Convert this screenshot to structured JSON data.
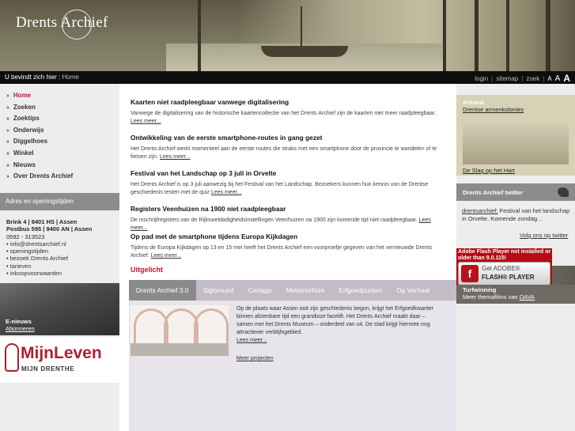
{
  "header": {
    "logo_text": "Drents Archief"
  },
  "topbar": {
    "breadcrumb_label": "U bevindt zich hier :",
    "breadcrumb_current": "Home",
    "links": [
      "login",
      "sitemap",
      "zoek"
    ],
    "font_sizes": [
      "A",
      "A",
      "A"
    ]
  },
  "nav": {
    "items": [
      {
        "label": "Home",
        "active": true
      },
      {
        "label": "Zoeken"
      },
      {
        "label": "Zoektips"
      },
      {
        "label": "Onderwijs"
      },
      {
        "label": "Diggelhoes"
      },
      {
        "label": "Winkel"
      },
      {
        "label": "Nieuws"
      },
      {
        "label": "Over Drents Archief"
      }
    ]
  },
  "address": {
    "heading": "Adres en openingstijden",
    "line1": "Brink 4 | 9401 HS | Assen",
    "line2": "Postbus 595 | 9400 AN | Assen",
    "phone": "0592 - 313523",
    "links": [
      "info@drentsarchief.nl",
      "openingstijden",
      "bezoek Drents Archief",
      "tarieven",
      "inkoopvoorwaarden"
    ]
  },
  "enews": {
    "title": "E-nieuws",
    "link": "Abonneren"
  },
  "mijnleven": {
    "title": "MijnLeven",
    "subtitle": "MIJN DRENTHE"
  },
  "news": [
    {
      "title": "Kaarten niet raadpleegbaar vanwege digitalisering",
      "body": "Vanwege de digitalisering van de historische kaartencollectie van het Drents Archief zijn de kaarten niet meer raadpleegbaar.",
      "more": "Lees meer..."
    },
    {
      "title": "Ontwikkeling van de eerste smartphone-routes in gang gezet",
      "body": "Het Drents Archief werkt momenteel aan de eerste routes die straks met een smartphone door de provincie te wandelen of te fietsen zijn.",
      "more": "Lees meer..."
    },
    {
      "title": "Festival van het Landschap op 3 juli in Orvelte",
      "body": "Het Drents Archief is op 3 juli aanwezig bij het Festival van het Landschap. Bezoekers kunnen hun kennis van de Drentse geschiedenis testen met de quiz",
      "more": "Lees meer..."
    },
    {
      "title": "Registers Veenhuizen na 1900 niet raadpleegbaar",
      "body": "De inschrijfregisters van de Rijksweldadigheidsinstellingen Veenhuizen na 1900 zijn komende tijd niet raadpleegbaar.",
      "more": "Lees meer..."
    },
    {
      "title": "Op pad met de smartphone tijdens Europa Kijkdagen",
      "body": "Tijdens de Europa Kijkdagen op 13 en 15 mei heeft het Drents Archief een voorproefje gegeven van het vernieuwde Drents Archief.",
      "more": "Lees meer..."
    }
  ],
  "uitgelicht": {
    "heading": "Uitgelicht",
    "tabs": [
      "Drents Archief 3.0",
      "Sigismund",
      "Cartago",
      "Metamorfoze",
      "Erfgoedpunten",
      "Op Verhaal"
    ],
    "active_tab": 0,
    "text": "Op de plaats waar Assen ooit zijn geschiedenis begon, krijgt het Erfgoedkwartier binnen afzienbare tijd een grandioze facelift. Het Drents Archief maakt daar – samen met het Drents Museum – onderdeel van uit. De stad krijgt hiermee nog attractiever verblijfsgebied.",
    "more": "Lees meer...",
    "projects_link": "Meer projecten"
  },
  "right": {
    "actueel_title": "Actueel",
    "actueel_link": "Drentse armenkolonies",
    "actueel_link2": "De Slag op het Hart",
    "twitter_heading": "Drents Archief twitter",
    "tweet_user": "drentsarchief:",
    "tweet_text": "Festival van het landschap in Orvelte. Komende zondag...",
    "twitter_follow": "Volg ons op twitter",
    "flash_notice": "Adobe Flash Player not installed or older than 9.0.115!",
    "flash_get": "Get ADOBE®",
    "flash_player": "FLASH® PLAYER",
    "turf_title": "Turfwinning",
    "turf_text": "Meer themafilms van",
    "turf_link": "DAVA"
  }
}
